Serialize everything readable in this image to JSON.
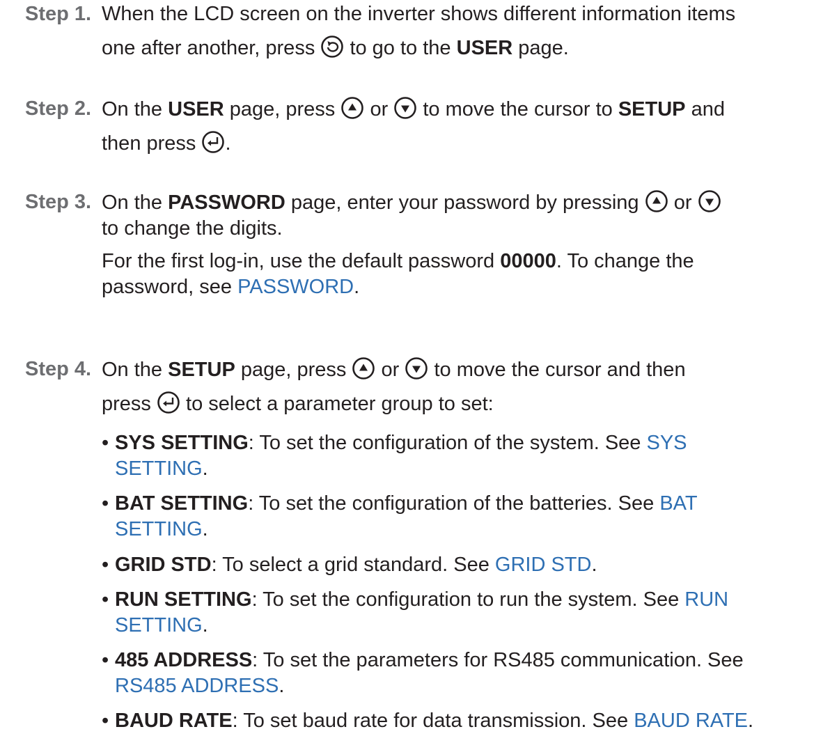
{
  "steps": [
    {
      "label": "Step 1.",
      "text1": "When the LCD screen on the inverter shows different information items",
      "text2": "one after another, press",
      "icon": "escape-icon",
      "text3": "to go to the",
      "bold1": "USER",
      "text4": "page."
    },
    {
      "label": "Step 2.",
      "text1": "On the",
      "bold1": "USER",
      "text2": "page, press",
      "icon_up": "up-arrow-icon",
      "or": "or",
      "icon_down": "down-arrow-icon",
      "text3": "to move the cursor to",
      "bold2": "SETUP",
      "text4": "and",
      "text5": "then press",
      "icon_enter": "enter-icon",
      "text6": "."
    },
    {
      "label": "Step 3.",
      "text1": "On the",
      "bold1": "PASSWORD",
      "text2": "page, enter your password by pressing",
      "or": "or",
      "text3": "to change the digits.",
      "text4": "For the first log-in, use the default password",
      "bold2": "00000",
      "text5": ". To change the",
      "text6": "password, see",
      "link1": "PASSWORD",
      "text7": "."
    },
    {
      "label": "Step 4.",
      "text1": "On the",
      "bold1": "SETUP",
      "text2": "page, press",
      "or": "or",
      "text3": "to move the cursor and then",
      "text4": "press",
      "text5": "to select a parameter group to set:",
      "bullets": [
        {
          "term": "SYS SETTING",
          "desc": ": To set the configuration of the system. See ",
          "link_a": "SYS",
          "link_b": "SETTING",
          "end": "."
        },
        {
          "term": "BAT SETTING",
          "desc": ": To set the configuration of the batteries. See ",
          "link_a": "BAT",
          "link_b": "SETTING",
          "end": "."
        },
        {
          "term": "GRID STD",
          "desc": ": To select a grid standard. See ",
          "link_a": "GRID STD",
          "end": "."
        },
        {
          "term": "RUN SETTING",
          "desc": ": To set the configuration to run the system. See ",
          "link_a": "RUN",
          "link_b": "SETTING",
          "end": "."
        },
        {
          "term": "485 ADDRESS",
          "desc": ": To set the parameters for RS485 communication. See",
          "link_b": "RS485 ADDRESS",
          "end": "."
        },
        {
          "term": "BAUD RATE",
          "desc": ": To set baud rate for data transmission. See ",
          "link_a": "BAUD RATE",
          "end": "."
        }
      ]
    }
  ]
}
